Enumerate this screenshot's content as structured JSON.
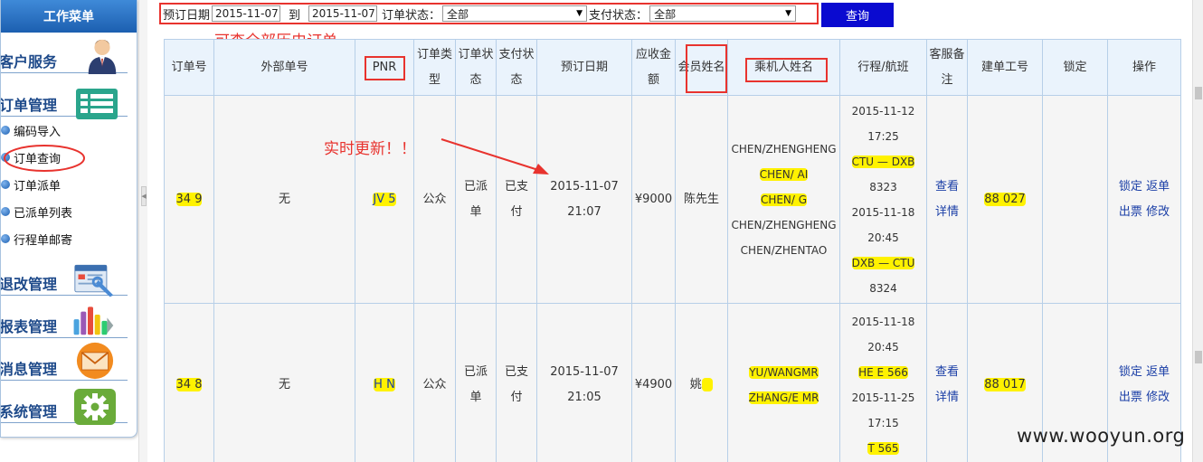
{
  "sidebar": {
    "header": "工作菜单",
    "sections": [
      {
        "label": "客户服务",
        "icon": "user-avatar-icon"
      },
      {
        "label": "订单管理",
        "icon": "order-list-icon"
      },
      {
        "label": "退改管理",
        "icon": "document-wrench-icon"
      },
      {
        "label": "报表管理",
        "icon": "bar-chart-icon"
      },
      {
        "label": "消息管理",
        "icon": "envelope-icon"
      },
      {
        "label": "系统管理",
        "icon": "gear-icon"
      }
    ],
    "order_items": [
      "编码导入",
      "订单查询",
      "订单派单",
      "已派单列表",
      "行程单邮寄"
    ]
  },
  "filter": {
    "date_label": "预订日期",
    "date_from": "2015-11-07",
    "to_label": "到",
    "date_to": "2015-11-07",
    "order_status_label": "订单状态：",
    "order_status_value": "全部",
    "pay_status_label": "支付状态：",
    "pay_status_value": "全部",
    "query_button": "查询"
  },
  "annotations": {
    "history": "可查全部历史订单",
    "realtime": "实时更新！！",
    "colors": {
      "annotation": "#e8332e",
      "highlight": "#fff200",
      "button": "#0a0ad0"
    }
  },
  "table": {
    "headers": [
      "订单号",
      "外部单号",
      "PNR",
      "订单类型",
      "订单状态",
      "支付状态",
      "预订日期",
      "应收金额",
      "会员姓名",
      "乘机人姓名",
      "行程/航班",
      "客服备注",
      "建单工号",
      "锁定",
      "操作"
    ],
    "rows": [
      {
        "order_no": "34  9",
        "external_no": "无",
        "pnr": "JV    5",
        "order_type": "公众",
        "order_status": "已派单",
        "pay_status": "已支付",
        "booking_date": "2015-11-07",
        "booking_time": "21:07",
        "amount": "¥9000",
        "member": "陈先生",
        "passengers": [
          "CHEN/ZHENGHENG",
          "CHEN/       AI",
          "CHEN/        G",
          "CHEN/ZHENGHENG",
          "CHEN/ZHENTAO"
        ],
        "itinerary": [
          "2015-11-12",
          "17:25",
          "CTU — DXB",
          "8323",
          "2015-11-18",
          "20:45",
          "DXB — CTU",
          "8324"
        ],
        "remark_lines": [
          "查看",
          "详情"
        ],
        "staff_no": "88   027",
        "locked": "",
        "ops": [
          "锁定",
          "返单",
          "出票",
          "修改"
        ]
      },
      {
        "order_no": "34  8",
        "external_no": "无",
        "pnr": "H      N",
        "order_type": "公众",
        "order_status": "已派单",
        "pay_status": "已支付",
        "booking_date": "2015-11-07",
        "booking_time": "21:05",
        "amount": "¥4900",
        "member": "姚",
        "passengers": [
          "YU/WANGMR",
          "ZHANG/E   MR"
        ],
        "itinerary": [
          "2015-11-18",
          "20:45",
          "HE    E 566",
          "2015-11-25",
          "17:15",
          "T      565"
        ],
        "remark_lines": [
          "查看",
          "详情"
        ],
        "staff_no": "88   017",
        "locked": "",
        "ops": [
          "锁定",
          "返单",
          "出票",
          "修改"
        ]
      }
    ]
  },
  "watermark": "www.wooyun.org"
}
